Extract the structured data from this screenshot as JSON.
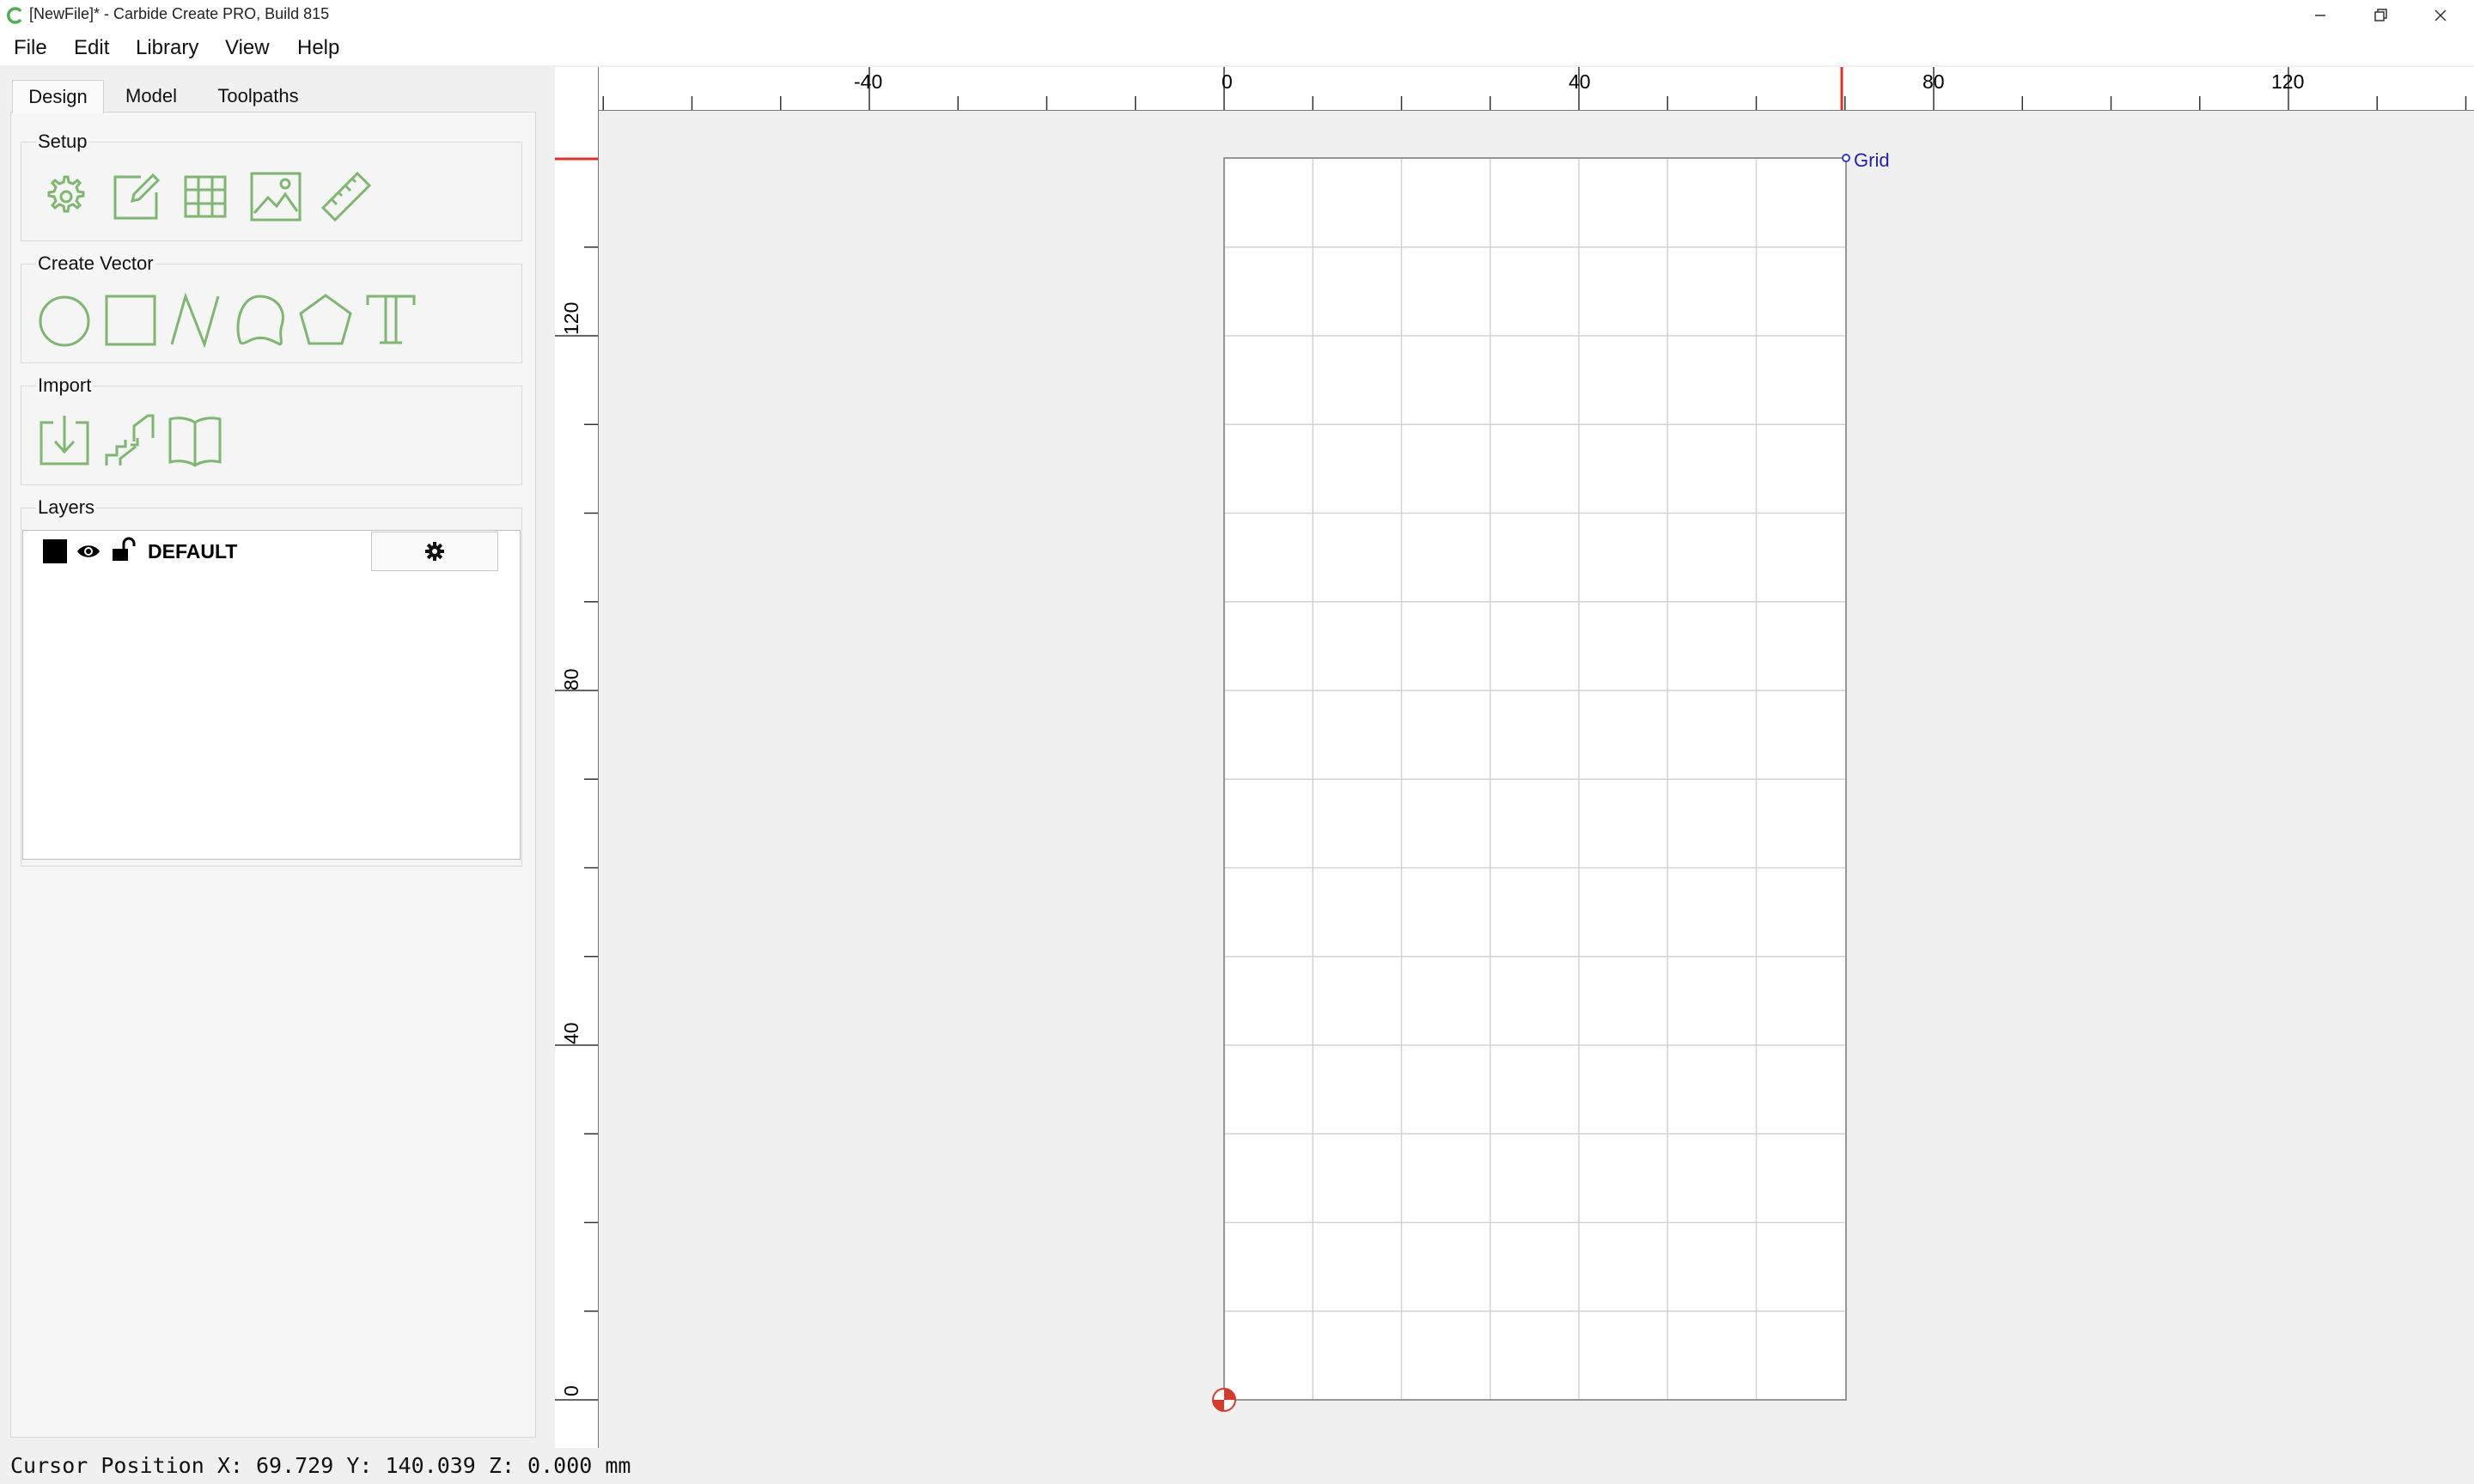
{
  "window": {
    "title": "[NewFile]* - Carbide Create PRO, Build 815",
    "app_icon": "carbide-c-icon",
    "controls": [
      "minimize-icon",
      "restore-icon",
      "close-icon"
    ]
  },
  "menu": {
    "items": [
      {
        "label": "File"
      },
      {
        "label": "Edit"
      },
      {
        "label": "Library"
      },
      {
        "label": "View"
      },
      {
        "label": "Help"
      }
    ]
  },
  "tabs": {
    "design": "Design",
    "model": "Model",
    "toolpaths": "Toolpaths",
    "active": "Design"
  },
  "setup": {
    "title": "Setup",
    "tools": [
      "gear-icon",
      "edit-note-icon",
      "grid-icon",
      "image-icon",
      "ruler-icon"
    ]
  },
  "create_vector": {
    "title": "Create Vector",
    "tools": [
      "circle-icon",
      "rectangle-icon",
      "polyline-icon",
      "curve-icon",
      "polygon-icon",
      "text-icon"
    ]
  },
  "import": {
    "title": "Import",
    "tools": [
      "import-file-icon",
      "import-model-icon",
      "library-book-icon"
    ]
  },
  "layers": {
    "title": "Layers",
    "items": [
      {
        "name": "DEFAULT",
        "color": "#000000",
        "visible": true,
        "locked": false
      }
    ]
  },
  "rulers": {
    "top_labels": [
      "-40",
      "0",
      "40",
      "80",
      "120"
    ],
    "left_labels": [
      "120",
      "80",
      "40",
      "0"
    ],
    "units": "mm"
  },
  "canvas": {
    "grid_label": "Grid",
    "accent_color": "#e0302a",
    "tool_color": "#7cb86e"
  },
  "status": {
    "text": "Cursor Position X: 69.729 Y: 140.039 Z: 0.000 mm"
  }
}
